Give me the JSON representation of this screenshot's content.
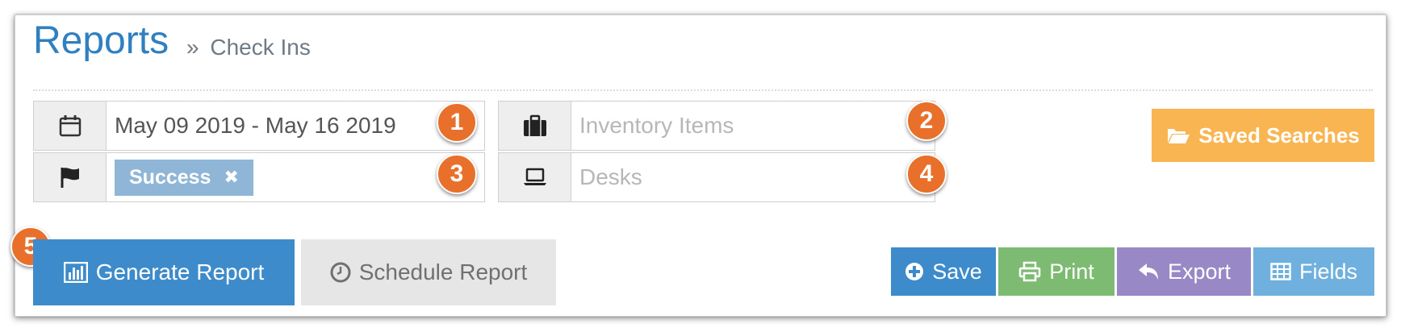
{
  "header": {
    "title": "Reports",
    "breadcrumb_sep": "»",
    "breadcrumb": "Check Ins"
  },
  "filters": {
    "date_range": {
      "value": "May 09 2019 - May 16 2019",
      "icon": "calendar-icon"
    },
    "inventory": {
      "placeholder": "Inventory Items",
      "icon": "briefcase-icon"
    },
    "status": {
      "tag": "Success",
      "tag_remove": "✖",
      "icon": "flag-icon"
    },
    "desks": {
      "placeholder": "Desks",
      "icon": "laptop-icon"
    }
  },
  "badges": [
    "1",
    "2",
    "3",
    "4",
    "5"
  ],
  "buttons": {
    "saved_searches": "Saved Searches",
    "generate": "Generate Report",
    "schedule": "Schedule Report",
    "save": "Save",
    "print": "Print",
    "export": "Export",
    "fields": "Fields"
  },
  "colors": {
    "title": "#2f7fc1",
    "badge": "#e8702a",
    "saved": "#f9b552",
    "generate": "#3e8bcb",
    "save": "#3e8bcb",
    "print": "#7dba72",
    "export": "#9888c6",
    "fields": "#6fb0de",
    "tag": "#8fb6d6"
  }
}
